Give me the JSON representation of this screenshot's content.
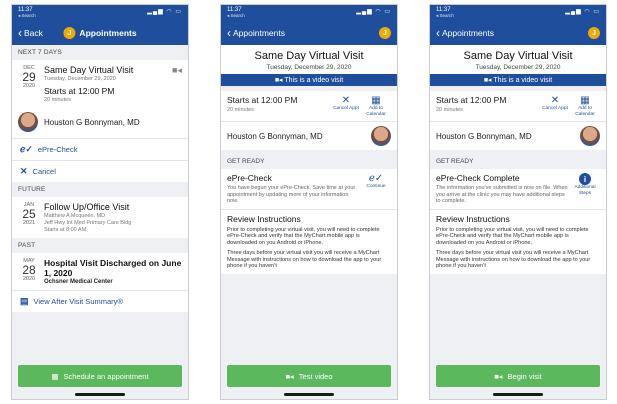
{
  "status": {
    "time": "11:37",
    "back_app": "◂ Search",
    "icons": "▂▄▆ ◠ ▭"
  },
  "screen1": {
    "nav": {
      "back_label": "Back",
      "title": "Appointments",
      "avatar_letter": "J"
    },
    "sections": {
      "next7": "NEXT 7 DAYS",
      "future": "FUTURE",
      "past": "PAST"
    },
    "next": {
      "month": "DEC",
      "day": "29",
      "year": "2020",
      "title": "Same Day Virtual Visit",
      "subtitle": "Tuesday, December 29, 2020",
      "starts": "Starts at 12:00 PM",
      "duration": "20 minutes",
      "doctor": "Houston G Bonnyman, MD",
      "epre_label": "ePre-Check",
      "cancel_label": "Cancel"
    },
    "future": {
      "month": "JAN",
      "day": "25",
      "year": "2021",
      "title": "Follow Up/Office Visit",
      "line1": "Matthew A Mcqueen, MD",
      "line2": "Jeff Hwy Int Med Primary Care Bldg",
      "line3": "Starts at 8:00 AM"
    },
    "past": {
      "month": "MAY",
      "day": "28",
      "year": "2020",
      "title": "Hospital Visit Discharged on June 1, 2020",
      "location": "Ochsner Medical Center",
      "summary_label": "View After Visit Summary®"
    },
    "schedule_label": "Schedule an appointment"
  },
  "detail": {
    "nav_back": "Appointments",
    "avatar_letter": "J",
    "title": "Same Day Virtual Visit",
    "date": "Tuesday, December 29, 2020",
    "video_banner": "This is a video visit",
    "starts": "Starts at 12:00 PM",
    "duration": "20 minutes",
    "cancel_label": "Cancel Appt",
    "calendar_label": "Add to Calendar",
    "doctor": "Houston G Bonnyman, MD",
    "get_ready": "GET READY",
    "review_title": "Review Instructions",
    "review_p1": "Prior to completing your virtual visit, you will need to complete ePre-Check and verify that the MyChart mobile app is downloaded on you Android or iPhone.",
    "review_p2": "Three days before your virtual visit you will receive a MyChart Message with instructions on how to download the app to your phone if you haven't"
  },
  "screen2": {
    "epc_title": "ePre-Check",
    "epc_text": "You have begun your ePre-Check. Save time at your appointment by updating more of your information now.",
    "epc_action": "Continue",
    "button_label": "Test video"
  },
  "screen3": {
    "epc_title": "ePre-Check Complete",
    "epc_text": "The information you've submitted is now on file. When you arrive at the clinic you may have additional steps to complete.",
    "epc_action": "Additional Steps",
    "button_label": "Begin visit"
  }
}
